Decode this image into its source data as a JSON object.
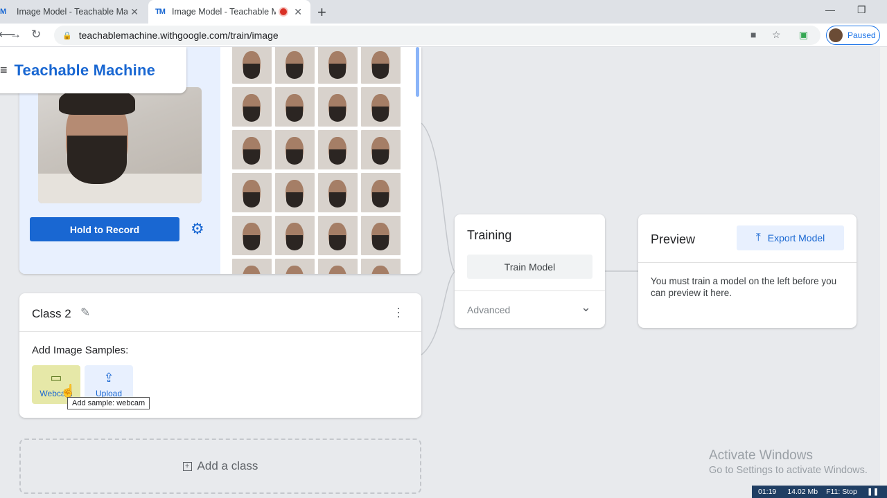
{
  "browser": {
    "tabs": [
      {
        "favicon": "M",
        "title": "Image Model - Teachable Machine"
      },
      {
        "favicon": "TM",
        "title": "Image Model - Teachable Machine"
      }
    ],
    "url": "teachablemachine.withgoogle.com/train/image",
    "profile_label": "Paused"
  },
  "app": {
    "brand": "Teachable Machine",
    "class1": {
      "record_label": "Hold to Record"
    },
    "class2": {
      "name": "Class 2",
      "add_samples_label": "Add Image Samples:",
      "webcam_label": "Webcam",
      "upload_label": "Upload",
      "tooltip": "Add sample: webcam"
    },
    "add_class_label": "Add a class",
    "training": {
      "title": "Training",
      "train_button": "Train Model",
      "advanced_label": "Advanced"
    },
    "preview": {
      "title": "Preview",
      "export_button": "Export Model",
      "message": "You must train a model on the left before you can preview it here."
    }
  },
  "os": {
    "activate_title": "Activate Windows",
    "activate_sub": "Go to Settings to activate Windows.",
    "recorder": {
      "time": "01:19",
      "size": "14.02 Mb",
      "stop": "F11: Stop"
    }
  }
}
